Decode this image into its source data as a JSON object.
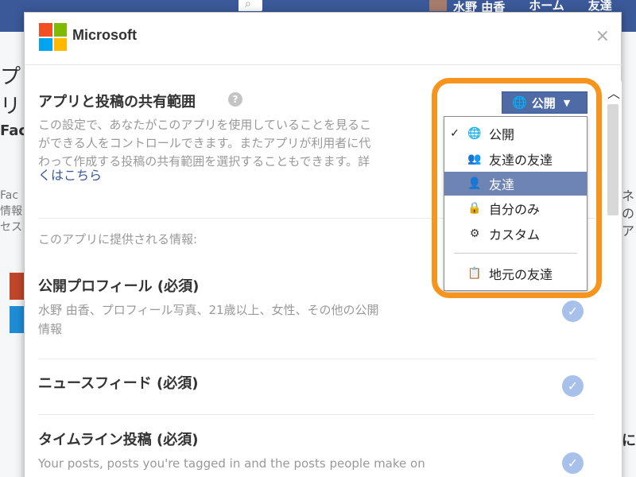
{
  "background": {
    "header_user": "水野 由香",
    "header_home": "ホーム",
    "header_friends": "友達",
    "left_fragments": [
      "プリ",
      "Fac",
      "Fac\n情報\nセス"
    ],
    "right_fragments": [
      "ネ\nの\nア",
      "に"
    ]
  },
  "dialog": {
    "brand": "Microsoft",
    "close_glyph": "×",
    "scroll_up_glyph": "⌃",
    "section_title": "アプリと投稿の共有範囲",
    "help_glyph": "?",
    "section_desc": "この設定で、あなたがこのアプリを使用していることを見るこ\nができる人をコントロールできます。またアプリが利用者に代\nわって作成する投稿の共有範囲を選択することもできます。詳",
    "learn_more": "くはこちら",
    "info_label": "このアプリに提供される情報:",
    "permissions": [
      {
        "title": "公開プロフィール (必須)",
        "desc": "水野 由香、プロフィール写真、21歳以上、女性、その他の公開\n情報"
      },
      {
        "title": "ニュースフィード (必須)",
        "desc": ""
      },
      {
        "title": "タイムライン投稿 (必須)",
        "desc": "Your posts, posts you're tagged in and the posts people make on"
      }
    ],
    "check_glyph": "✓"
  },
  "privacy": {
    "button_label": "公開",
    "globe_glyph": "🌐",
    "caret_glyph": "▼",
    "options": [
      {
        "label": "公開",
        "icon": "globe-icon",
        "glyph": "🌐",
        "checked": true
      },
      {
        "label": "友達の友達",
        "icon": "friends-of-friends-icon",
        "glyph": "👥",
        "checked": false
      },
      {
        "label": "友達",
        "icon": "friends-icon",
        "glyph": "👤",
        "checked": false,
        "highlighted": true
      },
      {
        "label": "自分のみ",
        "icon": "lock-icon",
        "glyph": "🔒",
        "checked": false
      },
      {
        "label": "カスタム",
        "icon": "gear-icon",
        "glyph": "⚙",
        "checked": false
      },
      {
        "label": "地元の友達",
        "icon": "local-friends-icon",
        "glyph": "📋",
        "checked": false
      }
    ],
    "check_mark": "✓"
  },
  "colors": {
    "facebook_blue": "#3b5998",
    "selected_item": "#6d84b4",
    "highlight_orange": "#f7941d",
    "ms_red": "#f25022",
    "ms_green": "#7fba00",
    "ms_blue": "#00a4ef",
    "ms_yellow": "#ffb900"
  }
}
